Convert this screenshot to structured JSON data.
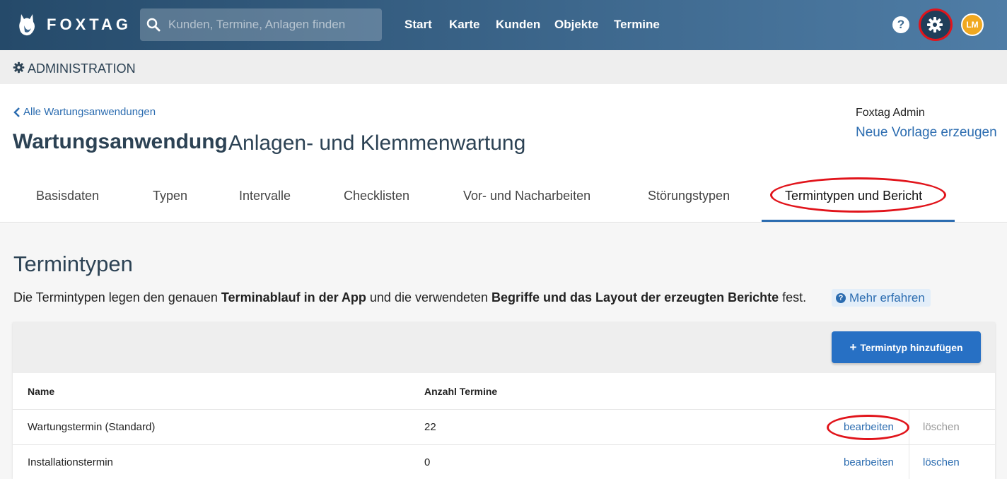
{
  "navbar": {
    "brand": "FOXTAG",
    "search_placeholder": "Kunden, Termine, Anlagen finden",
    "links": [
      "Start",
      "Karte",
      "Kunden",
      "Objekte",
      "Termine"
    ],
    "help_glyph": "?",
    "avatar_initials": "LM",
    "avatar_color": "#f0a820"
  },
  "admin_bar": {
    "title": "ADMINISTRATION"
  },
  "header": {
    "back_link": "Alle Wartungsanwendungen",
    "title": "Wartungsanwendung",
    "subtitle": "Anlagen- und Klemmenwartung",
    "user_name": "Foxtag Admin",
    "new_template_link": "Neue Vorlage erzeugen"
  },
  "tabs": [
    {
      "label": "Basisdaten",
      "active": false
    },
    {
      "label": "Typen",
      "active": false
    },
    {
      "label": "Intervalle",
      "active": false
    },
    {
      "label": "Checklisten",
      "active": false
    },
    {
      "label": "Vor- und Nacharbeiten",
      "active": false
    },
    {
      "label": "Störungstypen",
      "active": false
    },
    {
      "label": "Termintypen und Bericht",
      "active": true
    }
  ],
  "section": {
    "title": "Termintypen",
    "desc_1": "Die Termintypen legen den genauen ",
    "desc_2": "Terminablauf in der App",
    "desc_3": " und die verwendeten ",
    "desc_4": "Begriffe und das Layout der erzeugten Berichte",
    "desc_5": " fest.",
    "more_link": "Mehr erfahren"
  },
  "table": {
    "add_button": "Termintyp hinzufügen",
    "columns": [
      "Name",
      "Anzahl Termine"
    ],
    "rows": [
      {
        "name": "Wartungstermin (Standard)",
        "count": "22",
        "edit": "bearbeiten",
        "delete": "löschen",
        "delete_enabled": false
      },
      {
        "name": "Installationstermin",
        "count": "0",
        "edit": "bearbeiten",
        "delete": "löschen",
        "delete_enabled": true
      }
    ]
  },
  "colors": {
    "accent": "#2b6cb0",
    "button": "#2770c4",
    "annotation": "#e1141b",
    "disabled": "#999999"
  }
}
